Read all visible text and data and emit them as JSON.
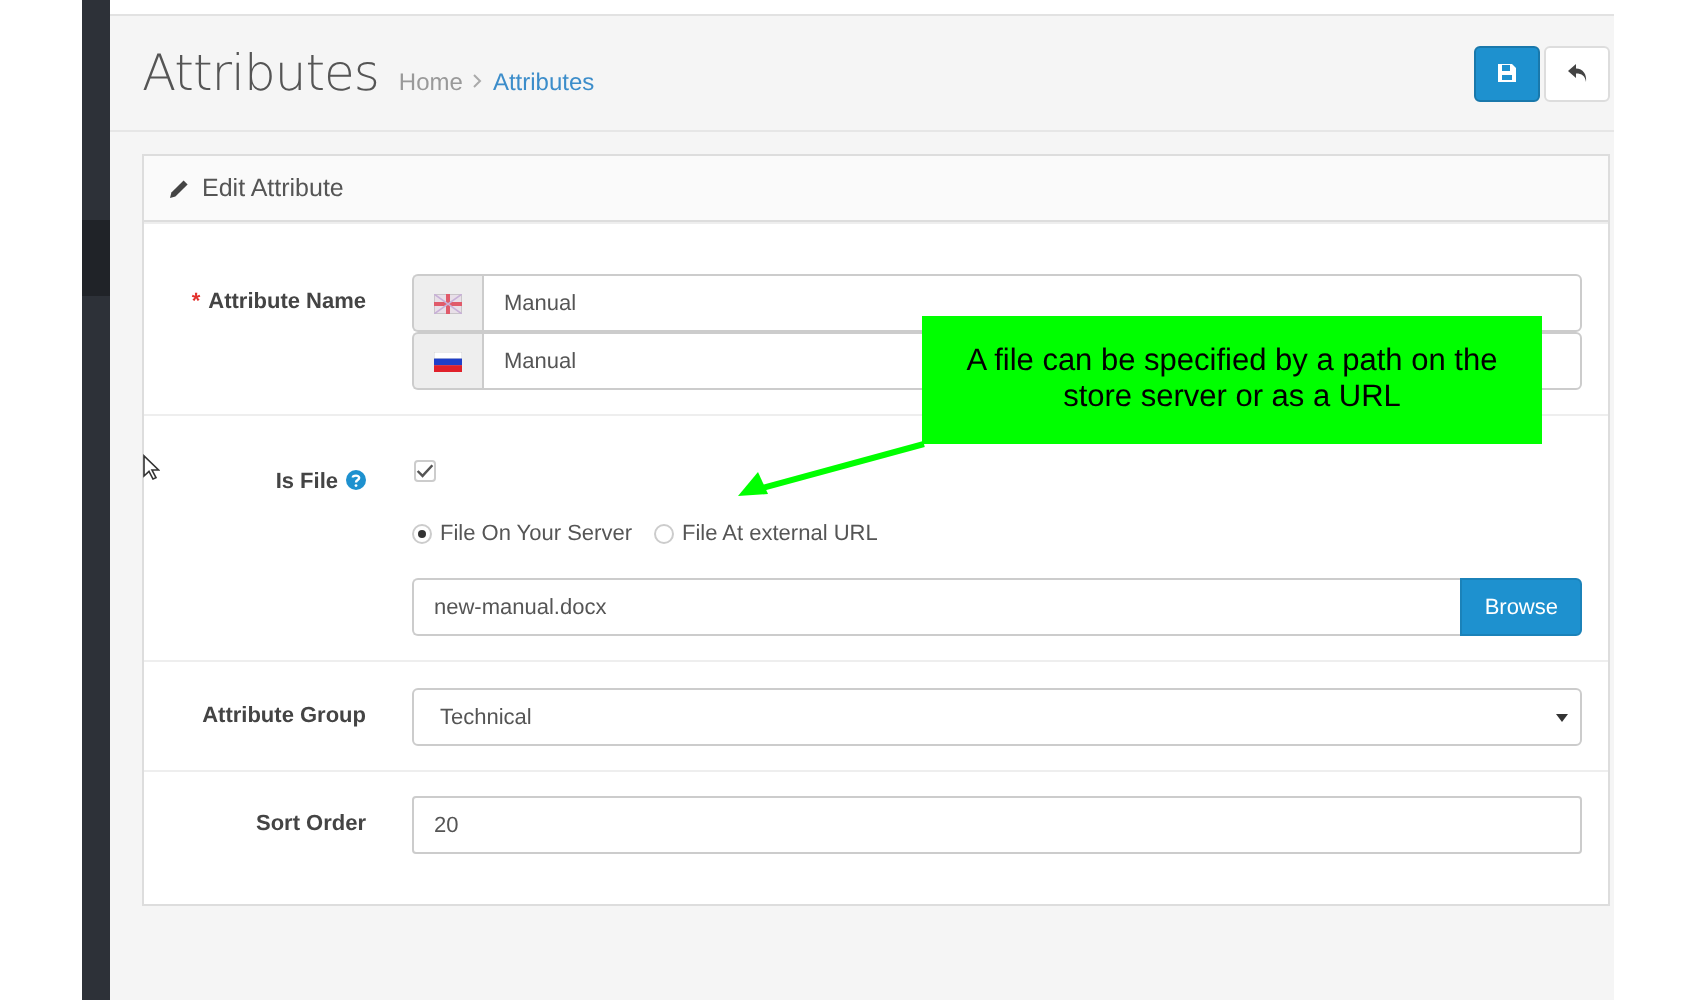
{
  "header": {
    "title": "Attributes",
    "breadcrumb": [
      {
        "label": "Home",
        "selected": false
      },
      {
        "label": "Attributes",
        "selected": true
      }
    ]
  },
  "panel": {
    "title": "Edit Attribute",
    "fields": [
      {
        "kind": "multilang",
        "label": "Attribute Name",
        "required_mark": "*",
        "values": [
          "Manual",
          "Manual"
        ]
      },
      {
        "kind": "file",
        "label": "Is File",
        "help": true,
        "checked": true,
        "options": [
          {
            "label": "File On Your Server",
            "selected": true
          },
          {
            "label": "File At external URL",
            "selected": false
          }
        ],
        "value": "new-manual.docx",
        "button": "Browse"
      },
      {
        "kind": "select",
        "label": "Attribute Group",
        "value": "Technical"
      },
      {
        "kind": "text",
        "label": "Sort Order",
        "value": "20"
      }
    ]
  },
  "callout": {
    "text": "A file can be specified by a path on the store server or as a URL"
  }
}
